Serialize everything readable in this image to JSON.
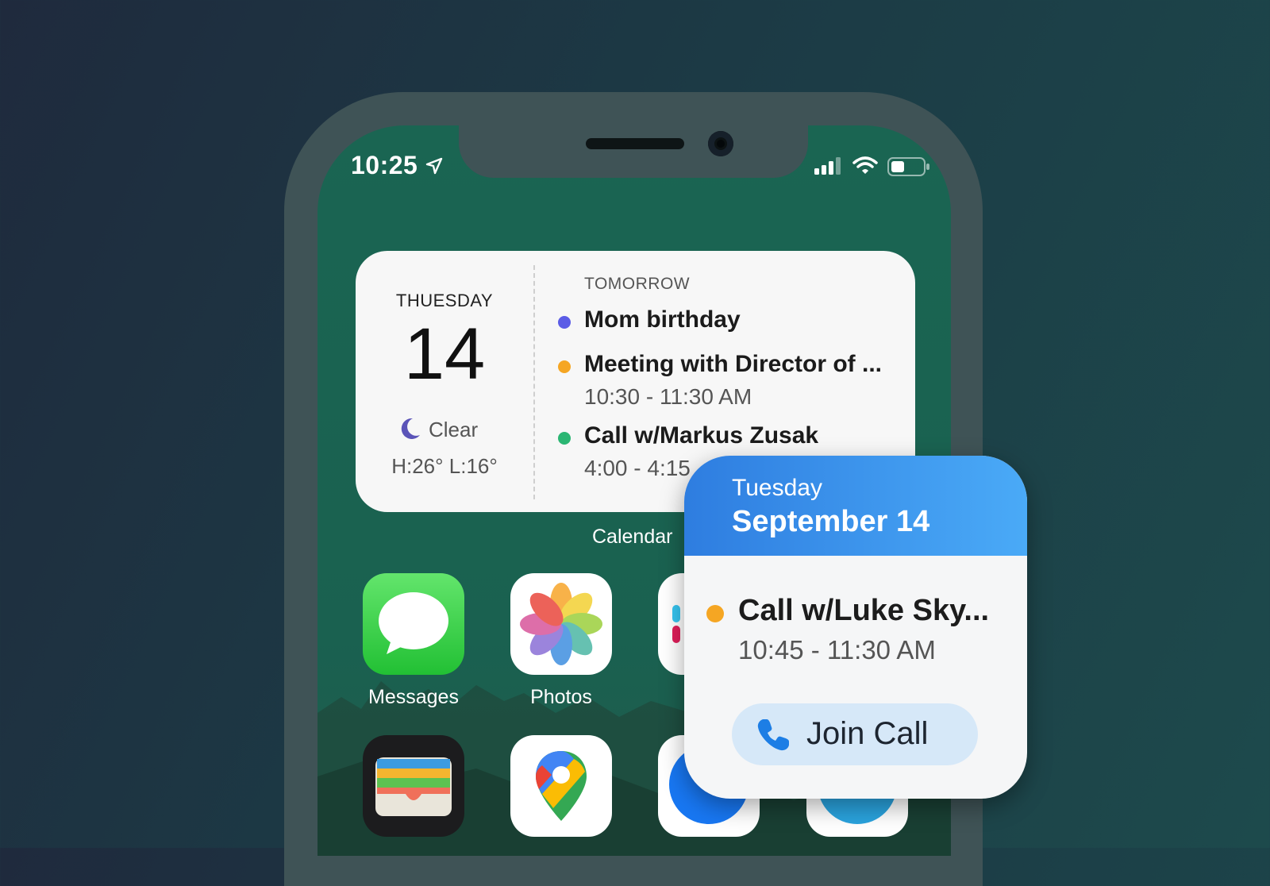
{
  "status_bar": {
    "time": "10:25"
  },
  "calendar_widget": {
    "weekday": "THUESDAY",
    "day_number": "14",
    "weather_condition": "Clear",
    "weather_high_low": "H:26° L:16°",
    "section_label": "TOMORROW",
    "events": [
      {
        "title": "Mom birthday",
        "time": "",
        "color": "#5b5ce6"
      },
      {
        "title": "Meeting with Director of ...",
        "time": "10:30 - 11:30 AM",
        "color": "#f5a623"
      },
      {
        "title": "Call w/Markus Zusak",
        "time": "4:00 - 4:15",
        "color": "#2bb673"
      }
    ],
    "label": "Calendar"
  },
  "apps": [
    {
      "label": "Messages",
      "icon": "messages-icon"
    },
    {
      "label": "Photos",
      "icon": "photos-icon"
    },
    {
      "label": "",
      "icon": "slack-icon"
    },
    {
      "label": "",
      "icon": "wallet-icon"
    },
    {
      "label": "",
      "icon": "google-maps-icon"
    },
    {
      "label": "",
      "icon": "messenger-icon"
    },
    {
      "label": "",
      "icon": "telegram-icon"
    }
  ],
  "event_popup": {
    "weekday": "Tuesday",
    "date": "September 14",
    "event_title": "Call w/Luke Sky...",
    "event_time": "10:45 - 11:30 AM",
    "event_color": "#f5a623",
    "action_label": "Join Call"
  },
  "colors": {
    "popup_header_start": "#2e7de0",
    "popup_header_end": "#4aaaf7",
    "join_button_bg": "#d6e8f8"
  }
}
